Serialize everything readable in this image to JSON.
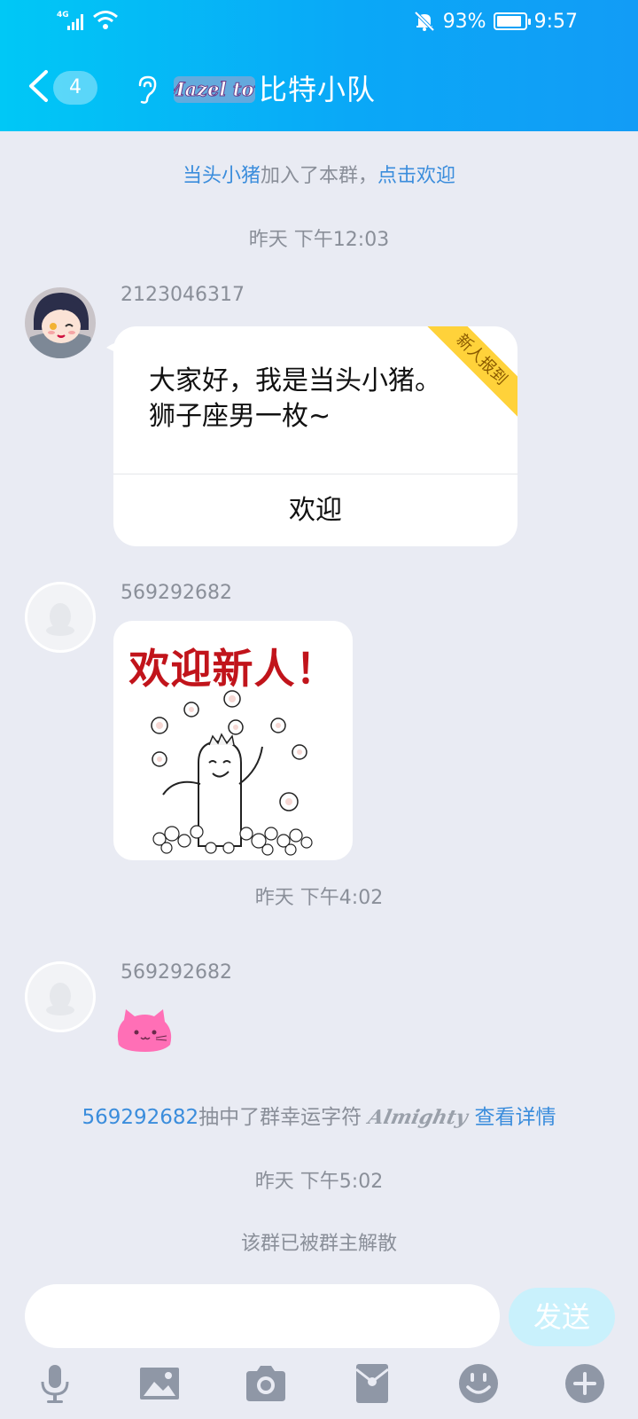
{
  "status_bar": {
    "network": "4G",
    "battery": "93%",
    "battery_level": 0.93,
    "time": "9:57"
  },
  "header": {
    "back_count": "4",
    "group_name": "比特小队",
    "logo_text": "Mazel tov"
  },
  "messages": {
    "join_notice": {
      "name": "当头小猪",
      "text": "加入了本群，",
      "link": "点击欢迎"
    },
    "time1": "昨天 下午12:03",
    "msg1": {
      "sender": "2123046317",
      "ribbon": "新人报到",
      "line1": "大家好，我是当头小猪。",
      "line2": "狮子座男一枚~",
      "button": "欢迎"
    },
    "msg2": {
      "sender": "569292682",
      "sticker_text": "欢迎新人！"
    },
    "time2": "昨天 下午4:02",
    "msg3": {
      "sender": "569292682"
    },
    "lucky": {
      "user": "569292682",
      "text": "抽中了群幸运字符",
      "word": "Almighty",
      "link": "查看详情"
    },
    "time3": "昨天 下午5:02",
    "dissolved": "该群已被群主解散"
  },
  "composer": {
    "input_value": "",
    "send_label": "发送"
  },
  "toolbar_icons": [
    "microphone-icon",
    "image-icon",
    "camera-icon",
    "red-packet-icon",
    "emoji-icon",
    "plus-icon"
  ],
  "colors": {
    "header_start": "#00c8f6",
    "header_end": "#129cf6",
    "link": "#3b8ddc",
    "background": "#e9ebf3",
    "send_disabled": "#c9f1fc"
  }
}
